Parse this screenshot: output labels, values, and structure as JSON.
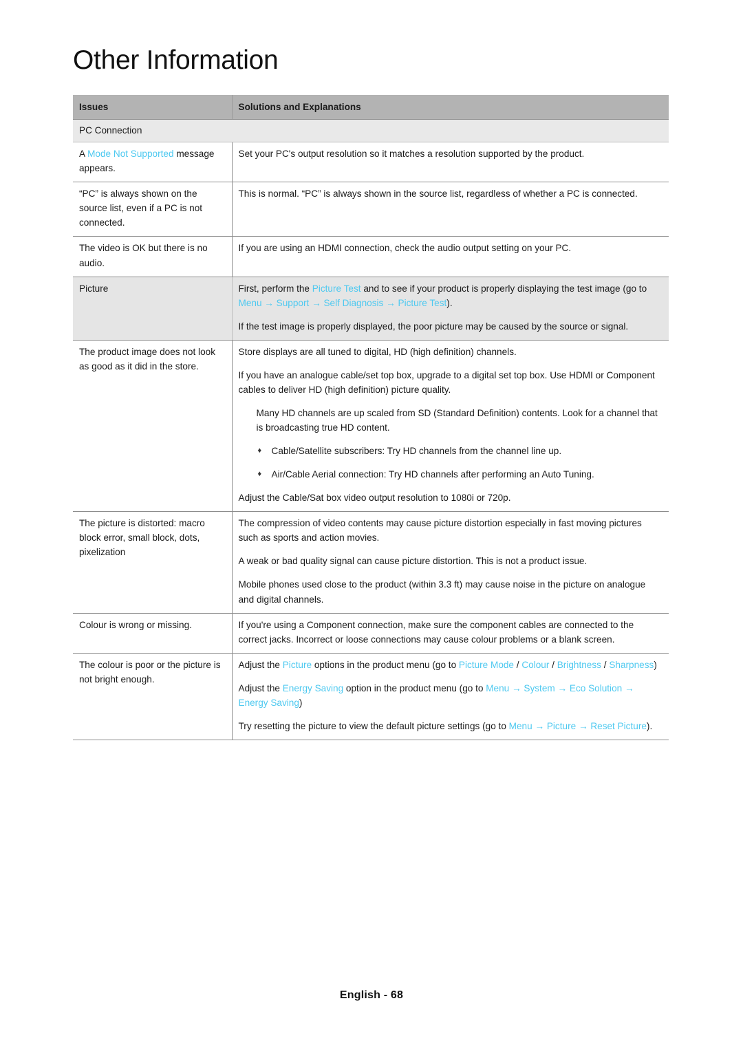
{
  "page": {
    "title": "Other Information",
    "footer": "English - 68",
    "accent_color": "#4ec9f0",
    "header_bg": "#b3b3b3",
    "section_bg": "#e9e9e9",
    "shaded_row_bg": "#e5e5e5"
  },
  "table": {
    "headers": {
      "issues": "Issues",
      "solutions": "Solutions and Explanations"
    },
    "section_label": "PC Connection",
    "rows": [
      {
        "issue_prefix": "A ",
        "issue_highlight": "Mode Not Supported",
        "issue_suffix": " message appears.",
        "solution_1": "Set your PC's output resolution so it matches a resolution supported by the product."
      },
      {
        "issue": "“PC” is always shown on the source list, even if a PC is not connected.",
        "solution_1": "This is normal. “PC” is always shown in the source list, regardless of whether a PC is connected."
      },
      {
        "issue": "The video is OK but there is no audio.",
        "solution_1": "If you are using an HDMI connection, check the audio output setting on your PC."
      },
      {
        "issue": "Picture",
        "sol_p1_a": "First, perform the ",
        "sol_p1_b": "Picture Test",
        "sol_p1_c": " and to see if your product is properly displaying the test image (go to ",
        "sol_p1_menu1": "Menu",
        "sol_p1_menu2": "Support",
        "sol_p1_menu3": "Self Diagnosis",
        "sol_p1_menu4": "Picture Test",
        "sol_p1_end": ").",
        "sol_p2": "If the test image is properly displayed, the poor picture may be caused by the source or signal."
      },
      {
        "issue": "The product image does not look as good as it did in the store.",
        "solution_1": "Store displays are all tuned to digital, HD (high definition) channels.",
        "solution_2": "If you have an analogue cable/set top box, upgrade to a digital set top box. Use HDMI or Component cables to deliver HD (high definition) picture quality.",
        "solution_3": "Many HD channels are up scaled from SD (Standard Definition) contents. Look for a channel that is broadcasting true HD content.",
        "bullet_1": "Cable/Satellite subscribers: Try HD channels from the channel line up.",
        "bullet_2": "Air/Cable Aerial connection: Try HD channels after performing an Auto Tuning.",
        "solution_4": "Adjust the Cable/Sat box video output resolution to 1080i or 720p."
      },
      {
        "issue": "The picture is distorted: macro block error, small block, dots, pixelization",
        "solution_1": "The compression of video contents may cause picture distortion especially in fast moving pictures such as sports and action movies.",
        "solution_2": "A weak or bad quality signal can cause picture distortion. This is not a product issue.",
        "solution_3": "Mobile phones used close to the product (within 3.3 ft) may cause noise in the picture on analogue and digital channels."
      },
      {
        "issue": "Colour is wrong or missing.",
        "solution_1": "If you're using a Component connection, make sure the component cables are connected to the correct jacks. Incorrect or loose connections may cause colour problems or a blank screen."
      },
      {
        "issue": "The colour is poor or the picture is not bright enough.",
        "p1_a": "Adjust the ",
        "p1_picture": "Picture",
        "p1_b": " options in the product menu (go to ",
        "p1_picture_mode": "Picture Mode",
        "p1_sep1": " / ",
        "p1_colour": "Colour",
        "p1_sep2": " / ",
        "p1_brightness": "Brightness",
        "p1_sep3": " / ",
        "p1_sharpness": "Sharpness",
        "p1_end": ")",
        "p2_a": "Adjust the ",
        "p2_energy": "Energy Saving",
        "p2_b": " option in the product menu (go to ",
        "p2_menu": "Menu",
        "p2_system": "System",
        "p2_eco": "Eco Solution",
        "p2_energy2": "Energy Saving",
        "p2_end": ")",
        "p3_a": "Try resetting the picture to view the default picture settings (go to ",
        "p3_menu": "Menu",
        "p3_picture": "Picture",
        "p3_reset": "Reset Picture",
        "p3_end": ")."
      }
    ]
  },
  "glyphs": {
    "arrow": "→",
    "bullet": "♦"
  }
}
